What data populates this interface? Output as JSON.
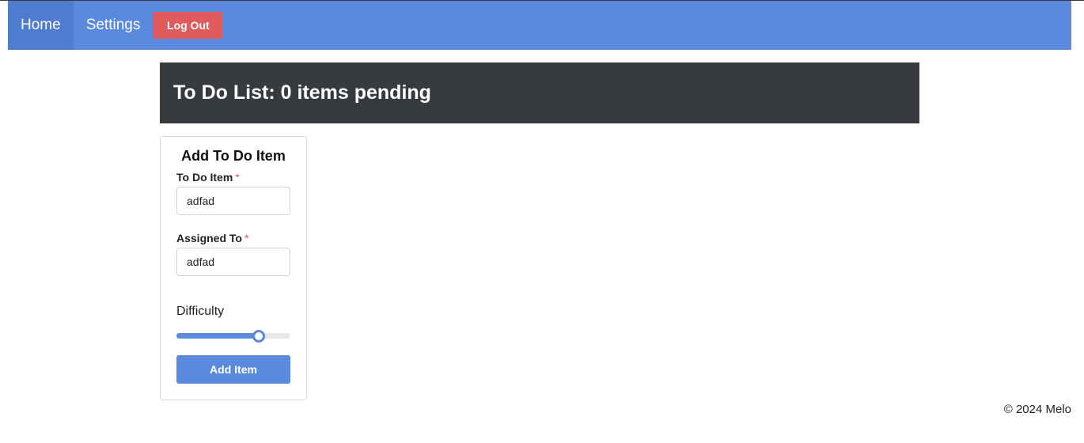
{
  "nav": {
    "links": [
      {
        "label": "Home",
        "active": true
      },
      {
        "label": "Settings",
        "active": false
      }
    ],
    "logout_label": "Log Out"
  },
  "header": {
    "title": "To Do List: 0 items pending"
  },
  "form": {
    "title": "Add To Do Item",
    "todo_label": "To Do Item",
    "todo_value": "adfad",
    "assigned_label": "Assigned To",
    "assigned_value": "adfad",
    "required_marker": "*",
    "difficulty_label": "Difficulty",
    "difficulty_fraction": 0.72,
    "submit_label": "Add Item"
  },
  "footer": {
    "text": "© 2024 Melo"
  },
  "colors": {
    "navbar": "#5a8ade",
    "navbar_active": "#4e7ccf",
    "logout": "#e05b5b",
    "header_bar": "#373a3f",
    "primary": "#5a8ade",
    "required": "#e05b5b"
  }
}
